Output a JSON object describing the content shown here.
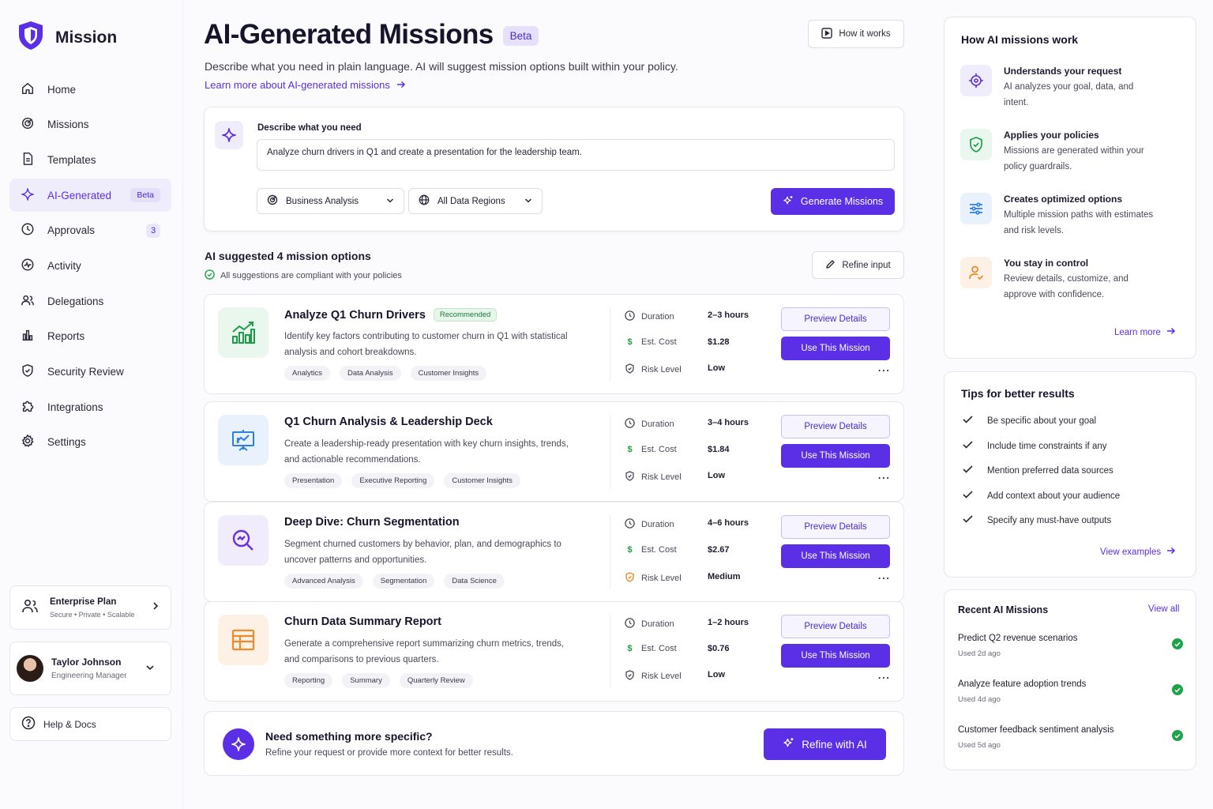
{
  "brand": {
    "name": "Mission"
  },
  "nav": [
    {
      "label": "Home",
      "icon": "home-icon"
    },
    {
      "label": "Missions",
      "icon": "target-icon"
    },
    {
      "label": "Templates",
      "icon": "document-icon"
    },
    {
      "label": "AI-Generated",
      "icon": "sparkle-icon",
      "badge": "Beta",
      "active": true
    },
    {
      "label": "Approvals",
      "icon": "clock-icon",
      "count": "3"
    },
    {
      "label": "Activity",
      "icon": "activity-icon"
    },
    {
      "label": "Delegations",
      "icon": "users-icon"
    },
    {
      "label": "Reports",
      "icon": "bar-chart-icon"
    },
    {
      "label": "Security Review",
      "icon": "shield-icon"
    },
    {
      "label": "Integrations",
      "icon": "puzzle-icon"
    },
    {
      "label": "Settings",
      "icon": "gear-icon"
    }
  ],
  "plan": {
    "title": "Enterprise Plan",
    "subtitle": "Secure • Private • Scalable"
  },
  "user": {
    "name": "Taylor Johnson",
    "role": "Engineering Manager"
  },
  "help": {
    "label": "Help & Docs"
  },
  "header": {
    "title": "AI-Generated Missions",
    "badge": "Beta",
    "how_button": "How it works",
    "subtitle": "Describe what you need in plain language. AI will suggest mission options built within your policy.",
    "learn_link": "Learn more about AI-generated missions"
  },
  "prompt": {
    "label": "Describe what you need",
    "value": "Analyze churn drivers in Q1 and create a presentation for the leadership team.",
    "category": "Business Analysis",
    "region": "All Data Regions",
    "generate_button": "Generate Missions"
  },
  "suggestions": {
    "title": "AI suggested 4 mission options",
    "compliance": "All suggestions are compliant with your policies",
    "refine_button": "Refine input",
    "labels": {
      "duration": "Duration",
      "cost": "Est. Cost",
      "risk": "Risk Level"
    },
    "preview_button": "Preview Details",
    "use_button": "Use This Mission",
    "more": "⋯",
    "items": [
      {
        "title": "Analyze Q1 Churn Drivers",
        "badge": "Recommended",
        "description": "Identify key factors contributing to customer churn in Q1 with statistical analysis and cohort breakdowns.",
        "tags": [
          "Analytics",
          "Data Analysis",
          "Customer Insights"
        ],
        "duration": "2–3 hours",
        "cost": "$1.28",
        "risk": "Low",
        "icon": "growth-chart-icon",
        "accent": "#1f9e4a",
        "bg": "#e9f7ee"
      },
      {
        "title": "Q1 Churn Analysis & Leadership Deck",
        "description": "Create a leadership-ready presentation with key churn insights, trends, and actionable recommendations.",
        "tags": [
          "Presentation",
          "Executive Reporting",
          "Customer Insights"
        ],
        "duration": "3–4 hours",
        "cost": "$1.84",
        "risk": "Low",
        "icon": "presentation-icon",
        "accent": "#2f7fe0",
        "bg": "#e8f1fc"
      },
      {
        "title": "Deep Dive: Churn Segmentation",
        "description": "Segment churned customers by behavior, plan, and demographics to uncover patterns and opportunities.",
        "tags": [
          "Advanced Analysis",
          "Segmentation",
          "Data Science"
        ],
        "duration": "4–6 hours",
        "cost": "$2.67",
        "risk": "Medium",
        "icon": "magnify-chart-icon",
        "accent": "#6a2fe0",
        "bg": "#f0ecfc"
      },
      {
        "title": "Churn Data Summary Report",
        "description": "Generate a comprehensive report summarizing churn metrics, trends, and comparisons to previous quarters.",
        "tags": [
          "Reporting",
          "Summary",
          "Quarterly Review"
        ],
        "duration": "1–2 hours",
        "cost": "$0.76",
        "risk": "Low",
        "icon": "table-icon",
        "accent": "#ec8a2c",
        "bg": "#fdf1e6"
      }
    ]
  },
  "cta": {
    "title": "Need something more specific?",
    "subtitle": "Refine your request or provide more context for better results.",
    "button": "Refine with AI"
  },
  "how_panel": {
    "title": "How AI missions work",
    "items": [
      {
        "title": "Understands your request",
        "desc": "AI analyzes your goal, data, and intent.",
        "icon": "brain-icon"
      },
      {
        "title": "Applies your policies",
        "desc": "Missions are generated within your policy guardrails.",
        "icon": "shield-check-icon"
      },
      {
        "title": "Creates optimized options",
        "desc": "Multiple mission paths with estimates and risk levels.",
        "icon": "sliders-icon"
      },
      {
        "title": "You stay in control",
        "desc": "Review details, customize, and approve with confidence.",
        "icon": "user-check-icon"
      }
    ],
    "link": "Learn more"
  },
  "tips": {
    "title": "Tips for better results",
    "items": [
      "Be specific about your goal",
      "Include time constraints if any",
      "Mention preferred data sources",
      "Add context about your audience",
      "Specify any must-have outputs"
    ],
    "link": "View examples"
  },
  "recent": {
    "title": "Recent AI Missions",
    "view_all": "View all",
    "items": [
      {
        "name": "Predict Q2 revenue scenarios",
        "used": "Used 2d ago"
      },
      {
        "name": "Analyze feature adoption trends",
        "used": "Used 4d ago"
      },
      {
        "name": "Customer feedback sentiment analysis",
        "used": "Used 5d ago"
      }
    ]
  },
  "colors": {
    "accent": "#5a2fe6",
    "success": "#1fa34a",
    "warning": "#ec8a2c"
  }
}
